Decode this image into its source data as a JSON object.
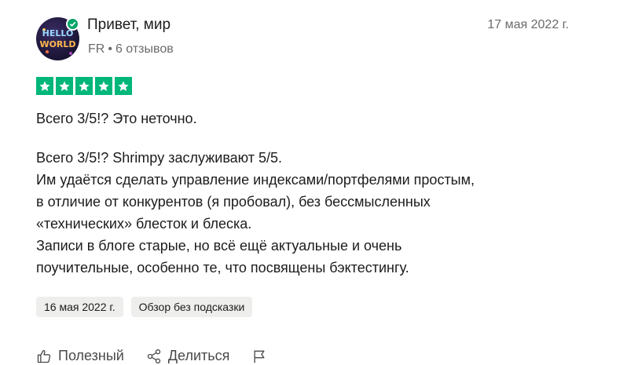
{
  "review": {
    "author_name": "Привет, мир",
    "author_country": "FR",
    "author_reviews": "6 отзывов",
    "date": "17 мая 2022 г.",
    "avatar_text_line1": "HELLO",
    "avatar_text_line2": "WORLD",
    "rating": 5,
    "rating_max": 5,
    "star_color": "#00b67a",
    "verified_color": "#04a568",
    "title": "Всего 3/5!? Это неточно.",
    "body_lines": [
      "Всего 3/5!? Shrimpy заслуживают 5/5.",
      "Им удаётся сделать управление индексами/портфелями простым,",
      "в отличие от конкурентов (я пробовал), без бессмысленных",
      "«технических» блесток и блеска.",
      "Записи в блоге старые, но всё ещё актуальные и очень",
      "поучительные, особенно те, что посвящены бэктестингу."
    ],
    "tags": [
      "16 мая 2022 г.",
      "Обзор без подсказки"
    ],
    "actions": {
      "useful_label": "Полезный",
      "share_label": "Делиться",
      "useful_icon": "thumbs-up-icon",
      "share_icon": "share-icon",
      "flag_icon": "flag-icon"
    }
  }
}
